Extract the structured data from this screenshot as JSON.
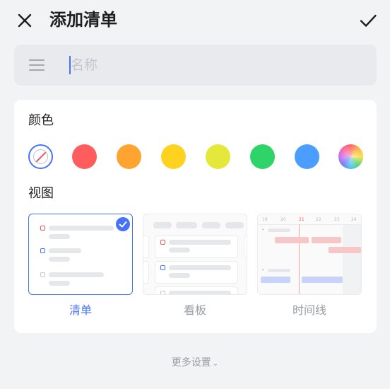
{
  "header": {
    "title": "添加清单",
    "close_icon": "close-icon",
    "confirm_icon": "checkmark-icon"
  },
  "name_field": {
    "placeholder": "名称",
    "value": "",
    "icon": "menu-lines-icon",
    "accent": "#4772fa"
  },
  "color_section": {
    "label": "颜色",
    "swatches": [
      {
        "name": "none",
        "color": "none",
        "selected": true
      },
      {
        "name": "red",
        "color": "#ff5d5d"
      },
      {
        "name": "orange",
        "color": "#ffa331"
      },
      {
        "name": "yellow",
        "color": "#ffd21f"
      },
      {
        "name": "lime",
        "color": "#e4e83b"
      },
      {
        "name": "green",
        "color": "#2fd468"
      },
      {
        "name": "blue",
        "color": "#4b9dff"
      },
      {
        "name": "custom",
        "color": "rainbow"
      }
    ]
  },
  "view_section": {
    "label": "视图",
    "options": [
      {
        "key": "list",
        "label": "清单",
        "selected": true
      },
      {
        "key": "kanban",
        "label": "看板",
        "selected": false
      },
      {
        "key": "timeline",
        "label": "时间线",
        "selected": false
      }
    ],
    "timeline_dates": [
      "19",
      "20",
      "21",
      "22",
      "23",
      "24"
    ]
  },
  "footer": {
    "more_settings": "更多设置",
    "more_icon": "chevron-down-icon"
  },
  "colors": {
    "accent": "#4772fa",
    "background": "#f2f3f5",
    "card": "#ffffff"
  }
}
